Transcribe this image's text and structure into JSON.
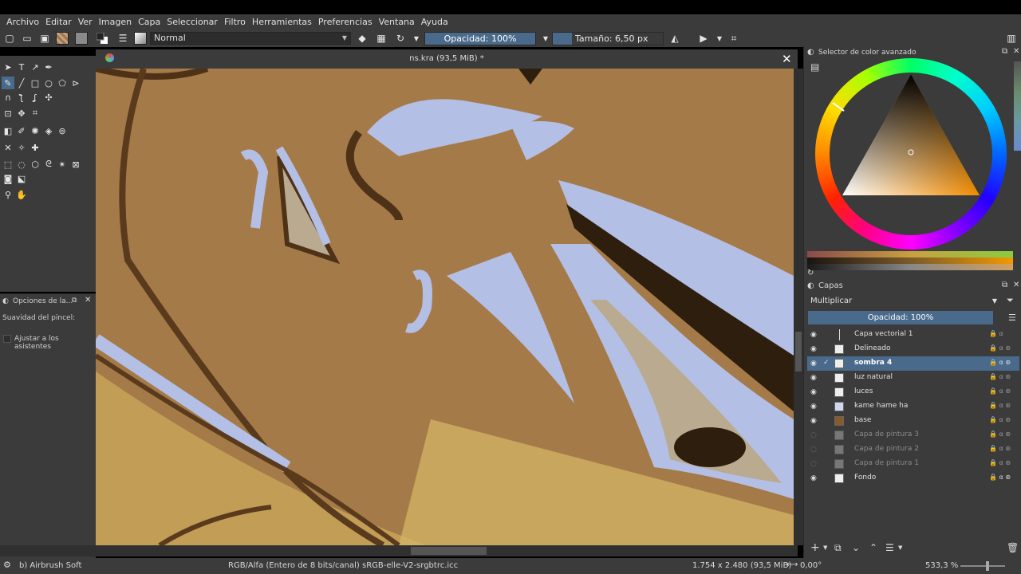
{
  "menubar": {
    "items": [
      "Archivo",
      "Editar",
      "Ver",
      "Imagen",
      "Capa",
      "Seleccionar",
      "Filtro",
      "Herramientas",
      "Preferencias",
      "Ventana",
      "Ayuda"
    ]
  },
  "toolbar": {
    "blend_mode": "Normal",
    "opacity_label": "Opacidad: 100%",
    "size_label": "Tamaño: 6,50 px"
  },
  "document": {
    "tab_title": "ns.kra (93,5 MiB) *"
  },
  "tool_options": {
    "title": "Opciones de la...",
    "brush_smoothing": "Suavidad del pincel:",
    "snap_to_assistants": "Ajustar a los asistentes"
  },
  "color_selector": {
    "title": "Selector de color avanzado"
  },
  "layers": {
    "title": "Capas",
    "blend_mode": "Multiplicar",
    "opacity_label": "Opacidad:  100%",
    "items": [
      {
        "name": "Capa vectorial 1",
        "visible": true,
        "selected": false
      },
      {
        "name": "Delineado",
        "visible": true,
        "selected": false
      },
      {
        "name": "sombra 4",
        "visible": true,
        "selected": true
      },
      {
        "name": "luz natural",
        "visible": true,
        "selected": false
      },
      {
        "name": "luces",
        "visible": true,
        "selected": false
      },
      {
        "name": "kame hame ha",
        "visible": true,
        "selected": false
      },
      {
        "name": "base",
        "visible": true,
        "selected": false
      },
      {
        "name": "Capa de pintura 3",
        "visible": false,
        "selected": false
      },
      {
        "name": "Capa de pintura 2",
        "visible": false,
        "selected": false
      },
      {
        "name": "Capa de pintura 1",
        "visible": false,
        "selected": false
      },
      {
        "name": "Fondo",
        "visible": true,
        "selected": false
      }
    ]
  },
  "status": {
    "brush": "b) Airbrush Soft",
    "color_space": "RGB/Alfa (Entero de 8 bits/canal)  sRGB-elle-V2-srgbtrc.icc",
    "dimensions": "1.754 x 2.480 (93,5 MiB)",
    "rotation": "0,00°",
    "zoom": "533,3 %"
  },
  "colors": {
    "accent": "#4a6a8c",
    "panel": "#3b3b3b",
    "canvas_skin": "#a57a49",
    "canvas_highlight": "#b4bfe6"
  }
}
